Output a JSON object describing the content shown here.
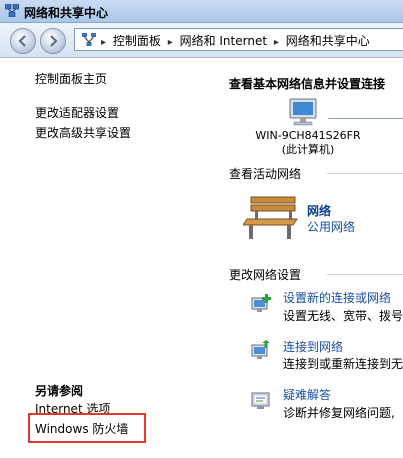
{
  "window": {
    "title": "网络和共享中心"
  },
  "addressbar": {
    "crumbs": [
      "控制面板",
      "网络和 Internet",
      "网络和共享中心"
    ]
  },
  "left_pane": {
    "links": [
      "控制面板主页",
      "更改适配器设置",
      "更改高级共享设置"
    ],
    "see_also_title": "另请参阅",
    "see_also_links": [
      "Internet 选项",
      "Windows 防火墙"
    ]
  },
  "main": {
    "title": "查看基本网络信息并设置连接",
    "computer_name": "WIN-9CH841S26FR",
    "computer_sub": "(此计算机)",
    "active_networks_heading": "查看活动网络",
    "network": {
      "name": "网络",
      "type": "公用网络"
    },
    "change_settings_heading": "更改网络设置",
    "tasks": [
      {
        "label": "设置新的连接或网络",
        "desc": "设置无线、宽带、拨号"
      },
      {
        "label": "连接到网络",
        "desc": "连接到或重新连接到无"
      },
      {
        "label": "疑难解答",
        "desc": "诊断并修复网络问题,"
      }
    ]
  },
  "colors": {
    "highlight": "#e8382f",
    "link": "#1a4fa3"
  }
}
